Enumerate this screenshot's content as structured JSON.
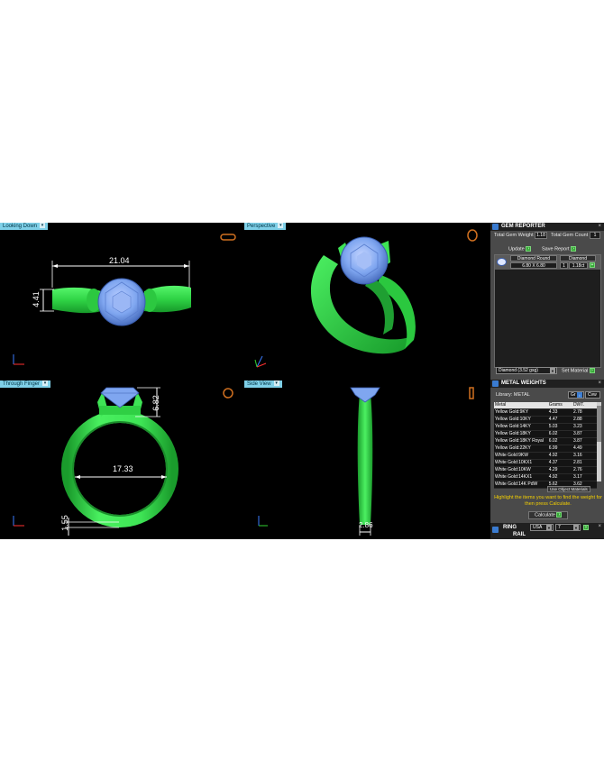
{
  "viewports": {
    "top_left": {
      "label": "Looking Down",
      "dim_width": "21.04",
      "dim_height": "4.41"
    },
    "top_right": {
      "label": "Perspective"
    },
    "bottom_left": {
      "label": "Through Finger",
      "dim_diameter": "17.33",
      "dim_gem_height": "6.82",
      "dim_band": "1.55"
    },
    "bottom_right": {
      "label": "Side View",
      "dim_width": "2.86"
    }
  },
  "gem_reporter": {
    "title": "GEM REPORTER",
    "total_weight_label": "Total Gem Weight",
    "total_weight_value": "1.18",
    "total_count_label": "Total Gem Count",
    "total_count_value": "1",
    "update_label": "Update",
    "save_report_label": "Save Report",
    "gem": {
      "name": "Diamond Round",
      "size": "6.80 X 6.80",
      "type": "Diamond",
      "count": "1",
      "carat": "1.18ct"
    },
    "material_select": "Diamond  (3.52 gsg)",
    "set_material_label": "Set Material"
  },
  "metal_weights": {
    "title": "METAL WEIGHTS",
    "library_label": "Library: METAL",
    "weight_select": "Gr",
    "view_select": "Cvw",
    "columns": [
      "Metal",
      "Grams",
      "DWT."
    ],
    "rows": [
      [
        "Yellow Gold:9KY",
        "4.33",
        "2.78"
      ],
      [
        "Yellow Gold:10KY",
        "4.47",
        "2.88"
      ],
      [
        "Yellow Gold:14KY",
        "5.03",
        "3.23"
      ],
      [
        "Yellow Gold:18KY",
        "6.02",
        "3.87"
      ],
      [
        "Yellow Gold:18KY Royal",
        "6.02",
        "3.87"
      ],
      [
        "Yellow Gold:22KY",
        "6.99",
        "4.49"
      ],
      [
        "White Gold:9KW",
        "4.92",
        "3.16"
      ],
      [
        "White Gold:10KX1",
        "4.37",
        "2.81"
      ],
      [
        "White Gold:10KW",
        "4.29",
        "2.76"
      ],
      [
        "White Gold:14KX1",
        "4.92",
        "3.17"
      ],
      [
        "White Gold:14K PdW",
        "5.62",
        "3.62"
      ]
    ],
    "use_object_materials": "Use Object Materials",
    "hint": "Highlight the items you want to find the weight for then press Calculate.",
    "calculate_label": "Calculate"
  },
  "ring_rail": {
    "title_line1": "RING",
    "title_line2": "RAIL",
    "standard": "USA",
    "size": "7"
  },
  "colors": {
    "ring": "#33e24f",
    "gem": "#7fa6f0",
    "dimension": "#ffffff",
    "panel": "#4a4a4a",
    "viewport_tab": "#7fd0e8",
    "hint": "#f5d000"
  }
}
